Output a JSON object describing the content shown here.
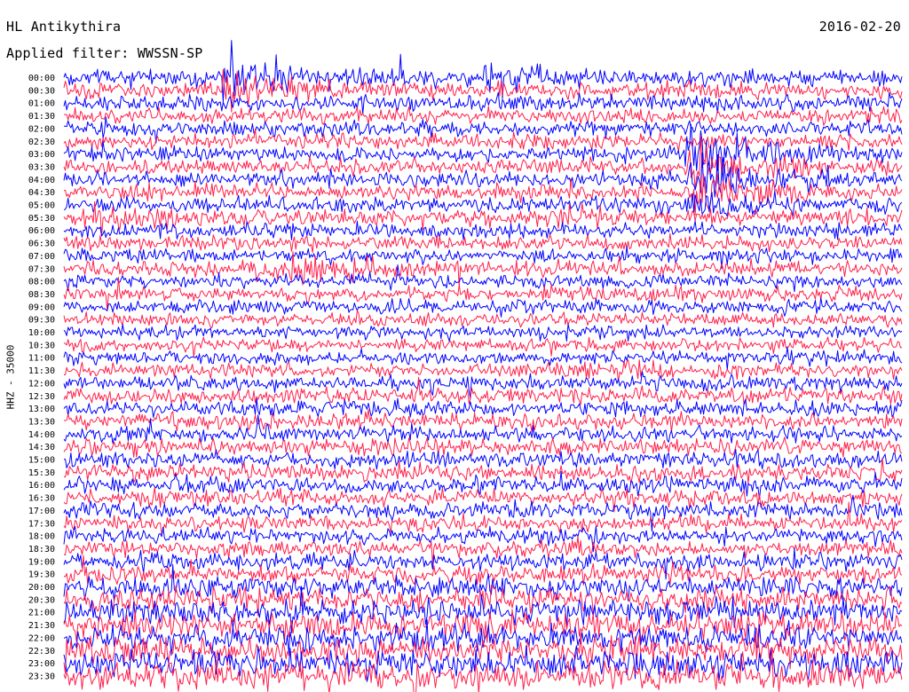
{
  "header": {
    "station": "HL Antikythira",
    "date": "2016-02-20",
    "filter": "Applied filter: WWSSN-SP"
  },
  "chart_data": {
    "type": "line",
    "title": "HL Antikythira",
    "subtitle": "Applied filter: WWSSN-SP",
    "date": "2016-02-20",
    "ylabel": "HHZ - 35000",
    "xlabel": "",
    "grid": false,
    "colors": [
      "#0000ff",
      "#ff1f4b"
    ],
    "rows": [
      "00:00",
      "00:30",
      "01:00",
      "01:30",
      "02:00",
      "02:30",
      "03:00",
      "03:30",
      "04:00",
      "04:30",
      "05:00",
      "05:30",
      "06:00",
      "06:30",
      "07:00",
      "07:30",
      "08:00",
      "08:30",
      "09:00",
      "09:30",
      "10:00",
      "10:30",
      "11:00",
      "11:30",
      "12:00",
      "12:30",
      "13:00",
      "13:30",
      "14:00",
      "14:30",
      "15:00",
      "15:30",
      "16:00",
      "16:30",
      "17:00",
      "17:30",
      "18:00",
      "18:30",
      "19:00",
      "19:30",
      "20:00",
      "20:30",
      "21:00",
      "21:30",
      "22:00",
      "22:30",
      "23:00",
      "23:30"
    ],
    "row_noise_level": [
      0.55,
      0.55,
      0.5,
      0.5,
      0.45,
      0.45,
      0.45,
      0.45,
      0.45,
      0.45,
      0.45,
      0.45,
      0.4,
      0.4,
      0.4,
      0.4,
      0.35,
      0.35,
      0.35,
      0.35,
      0.3,
      0.3,
      0.3,
      0.35,
      0.4,
      0.45,
      0.5,
      0.5,
      0.5,
      0.5,
      0.55,
      0.55,
      0.55,
      0.55,
      0.5,
      0.5,
      0.5,
      0.5,
      0.55,
      0.6,
      0.85,
      1.0,
      1.1,
      1.2,
      1.2,
      1.25,
      1.3,
      1.3
    ],
    "events": [
      {
        "row": "00:00",
        "minute": 5.8,
        "amplitude": 2.5
      },
      {
        "row": "00:00",
        "minute": 15.4,
        "amplitude": 1.6
      },
      {
        "row": "00:30",
        "minute": 5.8,
        "amplitude": 1.8
      },
      {
        "row": "03:00",
        "minute": 22.6,
        "amplitude": 4.0
      },
      {
        "row": "03:30",
        "minute": 22.6,
        "amplitude": 3.5
      },
      {
        "row": "04:00",
        "minute": 22.6,
        "amplitude": 3.0
      },
      {
        "row": "04:30",
        "minute": 22.6,
        "amplitude": 2.2
      },
      {
        "row": "05:00",
        "minute": 22.6,
        "amplitude": 1.6
      },
      {
        "row": "05:30",
        "minute": 1.0,
        "amplitude": 1.2
      },
      {
        "row": "05:30",
        "minute": 17.5,
        "amplitude": 1.0
      },
      {
        "row": "07:30",
        "minute": 7.0,
        "amplitude": 1.0
      },
      {
        "row": "07:30",
        "minute": 8.5,
        "amplitude": 1.4
      },
      {
        "row": "11:00",
        "minute": 25.5,
        "amplitude": 1.0
      },
      {
        "row": "11:30",
        "minute": 16.5,
        "amplitude": 0.9
      },
      {
        "row": "11:30",
        "minute": 18.5,
        "amplitude": 0.7
      }
    ]
  }
}
